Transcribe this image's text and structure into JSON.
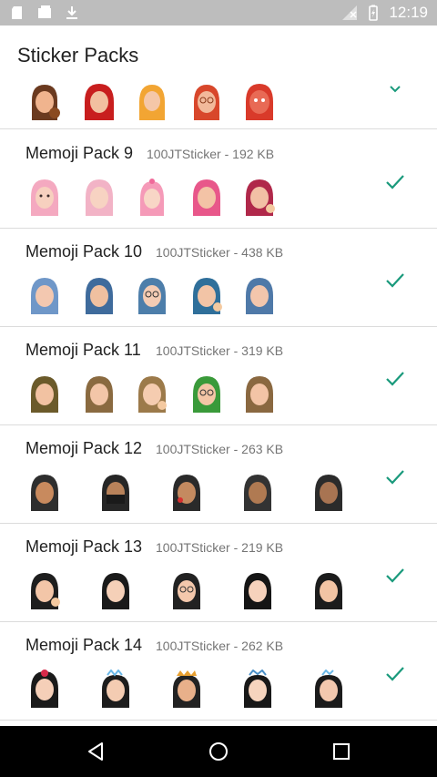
{
  "status_bar": {
    "time": "12:19"
  },
  "title": "Sticker Packs",
  "packs": [
    {
      "name": "Memoji Pack 9",
      "publisher": "100JTSticker",
      "size": "192 KB"
    },
    {
      "name": "Memoji Pack 10",
      "publisher": "100JTSticker",
      "size": "438 KB"
    },
    {
      "name": "Memoji Pack 11",
      "publisher": "100JTSticker",
      "size": "319 KB"
    },
    {
      "name": "Memoji Pack 12",
      "publisher": "100JTSticker",
      "size": "263 KB"
    },
    {
      "name": "Memoji Pack 13",
      "publisher": "100JTSticker",
      "size": "219 KB"
    },
    {
      "name": "Memoji Pack 14",
      "publisher": "100JTSticker",
      "size": "262 KB"
    }
  ],
  "separator": " - ",
  "colors": {
    "accent": "#1a9a7c",
    "status_bar": "#bdbdbd",
    "nav_bar": "#000000"
  },
  "icons": {
    "status_left": [
      "sd-card-icon",
      "photo-icon",
      "download-icon"
    ],
    "status_right": [
      "signal-icon",
      "battery-icon"
    ],
    "added": "check-icon",
    "nav": [
      "back-icon",
      "home-icon",
      "recents-icon"
    ]
  }
}
